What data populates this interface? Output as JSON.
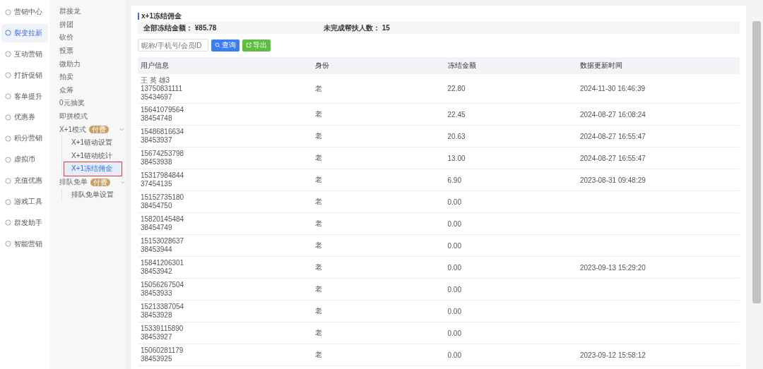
{
  "main_menu": [
    {
      "label": "营销中心",
      "selected": false
    },
    {
      "label": "裂变拉新",
      "selected": true
    },
    {
      "label": "互动营销",
      "selected": false
    },
    {
      "label": "打折促销",
      "selected": false
    },
    {
      "label": "客单提升",
      "selected": false
    },
    {
      "label": "优惠券",
      "selected": false
    },
    {
      "label": "积分营销",
      "selected": false
    },
    {
      "label": "虚拟币",
      "selected": false
    },
    {
      "label": "充值优惠",
      "selected": false
    },
    {
      "label": "游戏工具",
      "selected": false
    },
    {
      "label": "群发助手",
      "selected": false
    },
    {
      "label": "智能营销",
      "selected": false
    }
  ],
  "sub_menu": [
    {
      "label": "群接龙",
      "selected": false
    },
    {
      "label": "拼团",
      "selected": false
    },
    {
      "label": "砍价",
      "selected": false
    },
    {
      "label": "投票",
      "selected": false
    },
    {
      "label": "微助力",
      "selected": false
    },
    {
      "label": "拍卖",
      "selected": false
    },
    {
      "label": "众筹",
      "selected": false
    },
    {
      "label": "0元抽奖",
      "selected": false
    },
    {
      "label": "即拼模式",
      "selected": false
    },
    {
      "label": "X+1模式",
      "selected": false,
      "badge": "付费",
      "expanded": true,
      "children": [
        {
          "label": "X+1链动设置",
          "selected": false
        },
        {
          "label": "X+1链动统计",
          "selected": false
        },
        {
          "label": "X+1冻结佣金",
          "selected": true
        }
      ]
    },
    {
      "label": "排队免单",
      "selected": false,
      "badge": "付费",
      "expanded": true,
      "children": [
        {
          "label": "排队免单设置",
          "selected": false
        }
      ]
    }
  ],
  "page_title": "x+1冻结佣金",
  "summary": [
    {
      "label": "全部冻结金额：",
      "value": "¥85.78"
    },
    {
      "label": "未完成帮扶人数：",
      "value": "15"
    }
  ],
  "search": {
    "placeholder": "昵称/手机号/会员ID"
  },
  "buttons": [
    {
      "label": "查询",
      "kind": "search"
    },
    {
      "label": "导出",
      "kind": "export"
    }
  ],
  "table": {
    "columns": [
      "用户信息",
      "身份",
      "冻结金额",
      "数据更新时间"
    ],
    "rows": [
      {
        "user": [
          "王 英 雄3",
          "13750831111",
          "35434697"
        ],
        "identity": "老",
        "amount": "22.80",
        "updated": "2024-11-30 16:46:39"
      },
      {
        "user": [
          "15641079564",
          "38454748"
        ],
        "identity": "老",
        "amount": "22.45",
        "updated": "2024-08-27 16:08:24"
      },
      {
        "user": [
          "15486816634",
          "38453937"
        ],
        "identity": "老",
        "amount": "20.63",
        "updated": "2024-08-27 16:55:47"
      },
      {
        "user": [
          "15674253798",
          "38453938"
        ],
        "identity": "老",
        "amount": "13.00",
        "updated": "2024-08-27 16:55:47"
      },
      {
        "user": [
          "15317984844",
          "37454135"
        ],
        "identity": "老",
        "amount": "6.90",
        "updated": "2023-08-31 09:48:29"
      },
      {
        "user": [
          "15152735180",
          "38454750"
        ],
        "identity": "老",
        "amount": "0.00"
      },
      {
        "user": [
          "15820145484",
          "38454749"
        ],
        "identity": "老",
        "amount": "0.00"
      },
      {
        "user": [
          "15153028637",
          "38453944"
        ],
        "identity": "老",
        "amount": "0.00"
      },
      {
        "user": [
          "15841206301",
          "38453942"
        ],
        "identity": "老",
        "amount": "0.00",
        "updated": "2023-09-13 15:29:20"
      },
      {
        "user": [
          "15056267504",
          "38453933"
        ],
        "identity": "老",
        "amount": "0.00"
      },
      {
        "user": [
          "15213387054",
          "38453928"
        ],
        "identity": "老",
        "amount": "0.00"
      },
      {
        "user": [
          "15339115890",
          "38453927"
        ],
        "identity": "老",
        "amount": "0.00"
      },
      {
        "user": [
          "15060281179",
          "38453925"
        ],
        "identity": "老",
        "amount": "0.00",
        "updated": "2023-09-12 15:58:12"
      }
    ]
  }
}
